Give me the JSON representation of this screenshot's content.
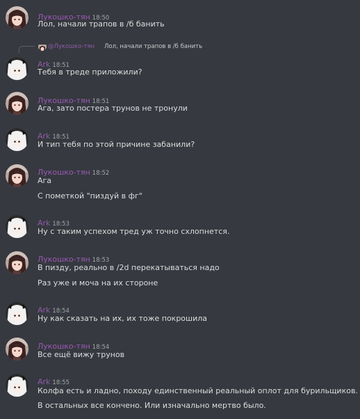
{
  "colors": {
    "background": "#36393f",
    "author_lukoshko": "#9b59b6",
    "author_ark": "#8e5ba8",
    "text": "#dcddde",
    "timestamp": "#a3a6aa"
  },
  "reply": {
    "author": "@Лукошко-тян",
    "text": "Лол, начали трапов в /б банить"
  },
  "messages": [
    {
      "author": "Лукошко-тян",
      "avatar": "anime-girl-avatar",
      "time": "18:50",
      "lines": [
        "Лол, начали трапов в /б банить"
      ]
    },
    {
      "author": "Ark",
      "avatar": "white-hair-avatar",
      "time": "18:51",
      "lines": [
        "Тебя в треде приложили?"
      ]
    },
    {
      "author": "Лукошко-тян",
      "avatar": "anime-girl-avatar",
      "time": "18:51",
      "lines": [
        "Ага, зато постера трунов не тронули"
      ]
    },
    {
      "author": "Ark",
      "avatar": "white-hair-avatar",
      "time": "18:51",
      "lines": [
        "И тип тебя по этой причине забанили?"
      ]
    },
    {
      "author": "Лукошко-тян",
      "avatar": "anime-girl-avatar",
      "time": "18:52",
      "lines": [
        "Ага",
        "С пометкой \"пиздуй в фг\""
      ]
    },
    {
      "author": "Ark",
      "avatar": "white-hair-avatar",
      "time": "18:53",
      "lines": [
        "Ну с таким успехом тред уж точно схлопнется."
      ]
    },
    {
      "author": "Лукошко-тян",
      "avatar": "anime-girl-avatar",
      "time": "18:53",
      "lines": [
        "В пизду, реально в /2d перекатываться надо",
        "Раз уже и моча на их стороне"
      ]
    },
    {
      "author": "Ark",
      "avatar": "white-hair-avatar",
      "time": "18:54",
      "lines": [
        "Ну как сказать на их, их тоже покрошила"
      ]
    },
    {
      "author": "Лукошко-тян",
      "avatar": "anime-girl-avatar",
      "time": "18:54",
      "lines": [
        "Все ещё вижу трунов"
      ]
    },
    {
      "author": "Ark",
      "avatar": "white-hair-avatar",
      "time": "18:55",
      "lines": [
        "Колфа есть и ладно, походу единственный реальный оплот для бурильщиков.",
        "В остальных все кончено. Или изначально мертво было."
      ]
    }
  ]
}
